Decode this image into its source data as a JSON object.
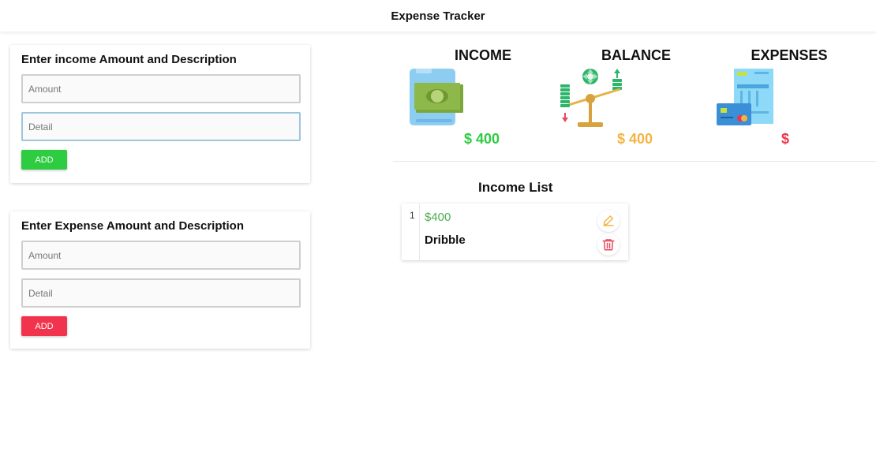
{
  "app": {
    "title": "Expense Tracker"
  },
  "income_form": {
    "heading": "Enter income Amount and Description",
    "amount_placeholder": "Amount",
    "detail_placeholder": "Detail",
    "add_label": "ADD"
  },
  "expense_form": {
    "heading": "Enter Expense Amount and Description",
    "amount_placeholder": "Amount",
    "detail_placeholder": "Detail",
    "add_label": "ADD"
  },
  "summary": {
    "income": {
      "label": "INCOME",
      "amount": "$ 400",
      "icon": "money-icon",
      "color": "#2ecc40"
    },
    "balance": {
      "label": "BALANCE",
      "amount": "$ 400",
      "icon": "scale-balance-icon",
      "color": "#f5b342"
    },
    "expenses": {
      "label": "EXPENSES",
      "amount": "$",
      "icon": "receipt-card-icon",
      "color": "#f2334d"
    }
  },
  "income_list": {
    "title": "Income List",
    "items": [
      {
        "index": "1",
        "amount": "$400",
        "description": "Dribble"
      }
    ]
  },
  "colors": {
    "income_green": "#2ecc40",
    "expense_red": "#f2334d",
    "balance_orange": "#f5b342",
    "edit_icon": "#f5b342",
    "delete_icon": "#e84a5f"
  }
}
